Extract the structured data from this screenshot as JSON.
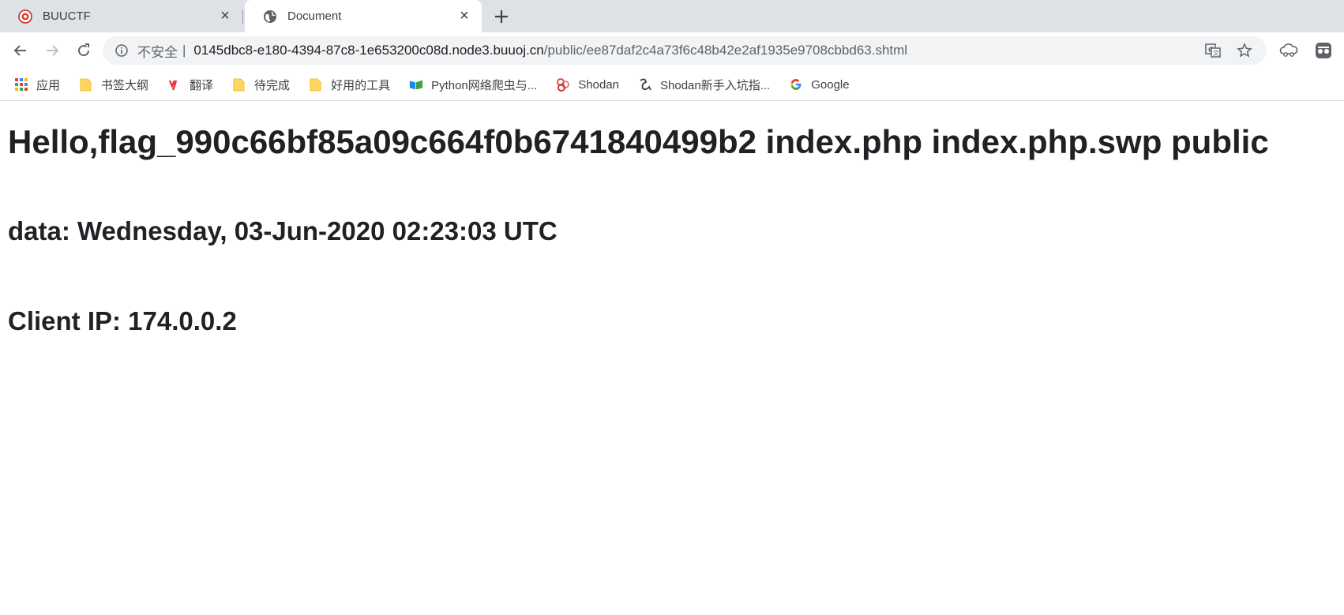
{
  "browser": {
    "tabs": [
      {
        "title": "BUUCTF",
        "favicon": "buuctf-logo-icon",
        "active": false
      },
      {
        "title": "Document",
        "favicon": "globe-icon",
        "active": true
      }
    ],
    "omnibox": {
      "security_label": "不安全",
      "separator": "|",
      "url_host": "0145dbc8-e180-4394-87c8-1e653200c08d.node3.buuoj.cn",
      "url_path": "/public/ee87daf2c4a73f6c48b42e2af1935e9708cbbd63.shtml"
    },
    "bookmarks": [
      {
        "label": "应用",
        "icon": "apps-grid-icon"
      },
      {
        "label": "书签大纲",
        "icon": "folder-icon"
      },
      {
        "label": "翻译",
        "icon": "youdao-icon"
      },
      {
        "label": "待完成",
        "icon": "folder-icon"
      },
      {
        "label": "好用的工具",
        "icon": "folder-icon"
      },
      {
        "label": "Python网络爬虫与...",
        "icon": "book-icon"
      },
      {
        "label": "Shodan",
        "icon": "shodan-icon"
      },
      {
        "label": "Shodan新手入坑指...",
        "icon": "shodan-guide-icon"
      },
      {
        "label": "Google",
        "icon": "google-icon"
      }
    ]
  },
  "page": {
    "heading": "Hello,flag_990c66bf85a09c664f0b6741840499b2 index.php index.php.swp public",
    "date_line": "data: Wednesday, 03-Jun-2020 02:23:03 UTC",
    "ip_line": "Client IP: 174.0.0.2"
  },
  "colors": {
    "tabstrip": "#dee1e6",
    "omnibox": "#f1f3f4",
    "url_path": "#5f6368"
  }
}
